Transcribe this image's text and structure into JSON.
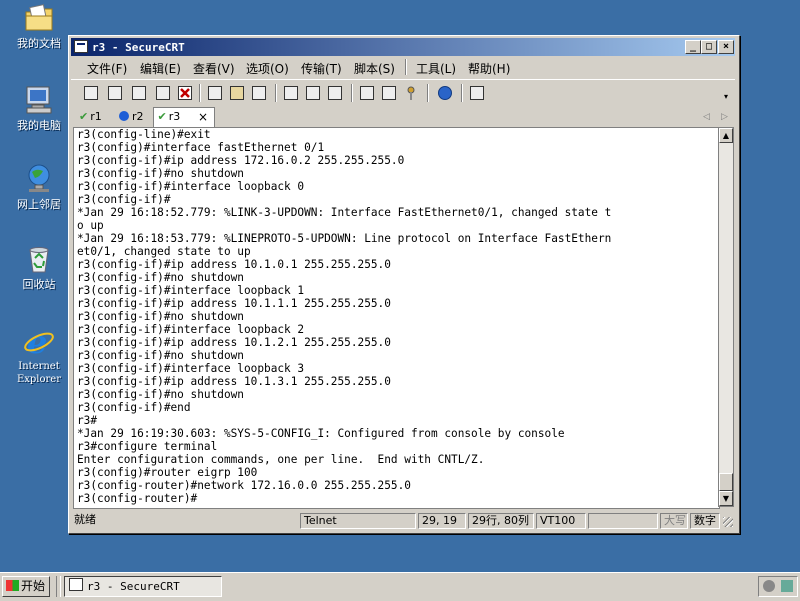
{
  "desktop": {
    "icons": [
      {
        "label": "我的文档",
        "icon": "folder-documents-icon"
      },
      {
        "label": "我的电脑",
        "icon": "computer-icon"
      },
      {
        "label": "网上邻居",
        "icon": "network-icon"
      },
      {
        "label": "回收站",
        "icon": "recycle-bin-icon"
      },
      {
        "label_line1": "Internet",
        "label_line2": "Explorer",
        "icon": "ie-icon"
      }
    ]
  },
  "window": {
    "title": "r3 - SecureCRT",
    "title_bar_color": "#0a246a"
  },
  "menu": [
    "文件(F)",
    "编辑(E)",
    "查看(V)",
    "选项(O)",
    "传输(T)",
    "脚本(S)",
    "工具(L)",
    "帮助(H)"
  ],
  "tabs": [
    {
      "label": "r1",
      "state": "connected"
    },
    {
      "label": "r2",
      "state": "info"
    },
    {
      "label": "r3",
      "state": "active"
    }
  ],
  "terminal": {
    "lines": [
      "r3(config-line)#exit",
      "r3(config)#interface fastEthernet 0/1",
      "r3(config-if)#ip address 172.16.0.2 255.255.255.0",
      "r3(config-if)#no shutdown",
      "r3(config-if)#interface loopback 0",
      "r3(config-if)#",
      "*Jan 29 16:18:52.779: %LINK-3-UPDOWN: Interface FastEthernet0/1, changed state t",
      "o up",
      "*Jan 29 16:18:53.779: %LINEPROTO-5-UPDOWN: Line protocol on Interface FastEthern",
      "et0/1, changed state to up",
      "r3(config-if)#ip address 10.1.0.1 255.255.255.0",
      "r3(config-if)#no shutdown",
      "r3(config-if)#interface loopback 1",
      "r3(config-if)#ip address 10.1.1.1 255.255.255.0",
      "r3(config-if)#no shutdown",
      "r3(config-if)#interface loopback 2",
      "r3(config-if)#ip address 10.1.2.1 255.255.255.0",
      "r3(config-if)#no shutdown",
      "r3(config-if)#interface loopback 3",
      "r3(config-if)#ip address 10.1.3.1 255.255.255.0",
      "r3(config-if)#no shutdown",
      "r3(config-if)#end",
      "r3#",
      "*Jan 29 16:19:30.603: %SYS-5-CONFIG_I: Configured from console by console",
      "r3#configure terminal",
      "Enter configuration commands, one per line.  End with CNTL/Z.",
      "r3(config)#router eigrp 100",
      "r3(config-router)#network 172.16.0.0 255.255.255.0",
      "r3(config-router)#"
    ]
  },
  "status": {
    "ready": "就绪",
    "protocol": "Telnet",
    "cursor": "29, 19",
    "size": "29行, 80列",
    "emulation": "VT100",
    "blank": "",
    "caps": "大写",
    "num": "数字"
  },
  "taskbar": {
    "start_label": "开始",
    "task_label": "r3 - SecureCRT"
  }
}
